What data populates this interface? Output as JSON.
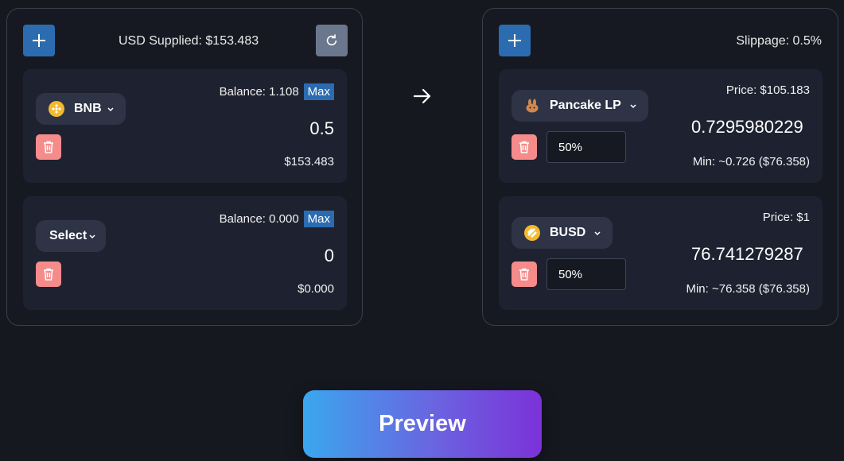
{
  "supply": {
    "usd_supplied": "USD Supplied: $153.483",
    "inputs": [
      {
        "token": "BNB",
        "balance": "Balance: 1.108",
        "max_label": "Max",
        "amount": "0.5",
        "usd": "$153.483"
      },
      {
        "token": "Select",
        "balance": "Balance: 0.000",
        "max_label": "Max",
        "amount": "0",
        "usd": "$0.000"
      }
    ]
  },
  "receive": {
    "slippage": "Slippage: 0.5%",
    "outputs": [
      {
        "token": "Pancake LP",
        "price": "Price: $105.183",
        "amount": "0.7295980229",
        "percent": "50%",
        "min": "Min: ~0.726 ($76.358)"
      },
      {
        "token": "BUSD",
        "price": "Price: $1",
        "amount": "76.741279287",
        "percent": "50%",
        "min": "Min: ~76.358 ($76.358)"
      }
    ]
  },
  "preview_label": "Preview",
  "colors": {
    "accent": "#2b6cb0",
    "delete": "#f58b8b",
    "bnb": "#f3ba2f",
    "gradient_start": "#3aa7ee",
    "gradient_end": "#7c32d9"
  }
}
